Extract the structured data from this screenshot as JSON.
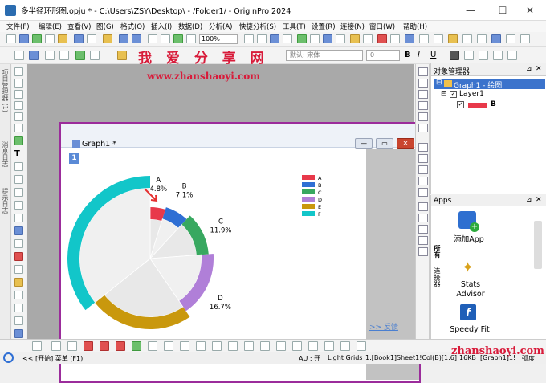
{
  "window": {
    "title": "多半径环形图.opju * - C:\\Users\\ZSY\\Desktop\\ - /Folder1/ - OriginPro 2024",
    "minimize": "—",
    "maximize": "☐",
    "close": "✕"
  },
  "menu": [
    "文件(F)",
    "编辑(E)",
    "查看(V)",
    "图(G)",
    "格式(O)",
    "插入(I)",
    "数据(D)",
    "分析(A)",
    "快捷分析(S)",
    "工具(T)",
    "设置(R)",
    "连接(N)",
    "窗口(W)",
    "帮助(H)"
  ],
  "toolbar": {
    "zoom": "100%",
    "font": "默认: 宋体",
    "font_size": "0"
  },
  "watermark": {
    "top_text": "我 爱 分 享 网",
    "url": "www.zhanshaoyi.com",
    "bottom_url": "zhanshaoyi.com"
  },
  "left_tabs": [
    "项目管理器 (1)",
    "消息日志",
    "提示日志"
  ],
  "graph": {
    "window_title": "Graph1 *",
    "layer_number": "1",
    "back_link": ">> 反馈"
  },
  "chart_data": {
    "type": "pie",
    "variant": "multi-radius ring",
    "categories": [
      "A",
      "B",
      "C",
      "D",
      "E",
      "F"
    ],
    "values": [
      4.8,
      7.1,
      11.9,
      16.7,
      23.8,
      35.7
    ],
    "labels": [
      "4.8%",
      "7.1%",
      "11.9%",
      "16.7%",
      "23.8%",
      "35.7%"
    ],
    "colors": [
      "#e8394a",
      "#2f6fd4",
      "#38a860",
      "#b07fd8",
      "#c9980d",
      "#12c6c9"
    ],
    "legend": [
      "A",
      "B",
      "C",
      "D",
      "E",
      "F"
    ],
    "legend_position": "top-right",
    "start_angle_deg": 0,
    "direction": "clockwise"
  },
  "object_manager": {
    "title": "对象管理器",
    "graph_node": "Graph1 - 绘图",
    "layer_node": "Layer1",
    "plot_node": "B"
  },
  "apps": {
    "title": "Apps",
    "tabs": [
      "所有",
      "连接器"
    ],
    "items": [
      "添加App",
      "Stats Advisor",
      "Speedy Fit"
    ]
  },
  "statusbar": {
    "start": "<<  [开始] 菜单 (F1)",
    "au": "AU : 开",
    "grids": "Light Grids",
    "cell": "1:[Book1]Sheet1!Col(B)[1:6]",
    "size": "16KB",
    "graph": "[Graph1]1!",
    "unit": "弧度"
  }
}
